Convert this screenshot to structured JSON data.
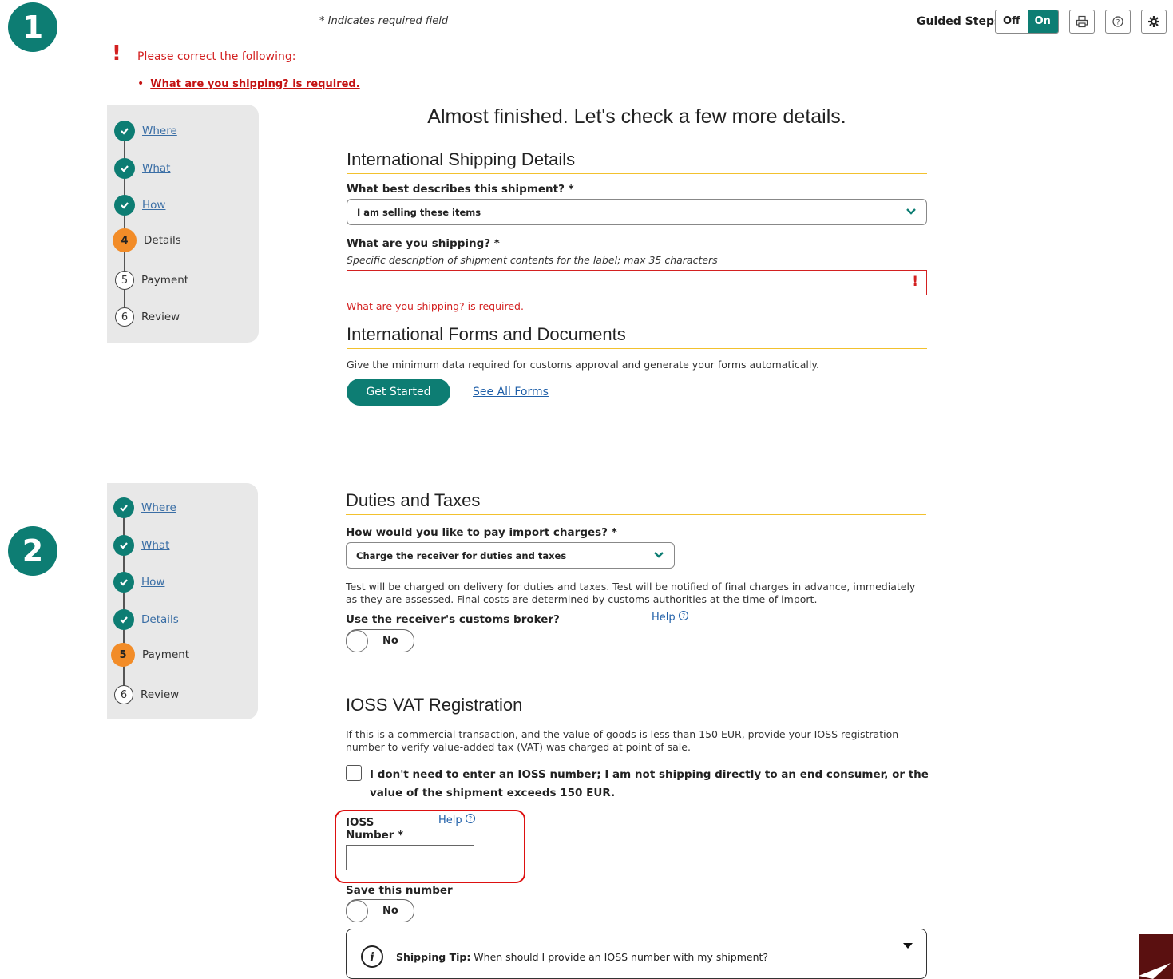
{
  "markers": {
    "one": "1",
    "two": "2"
  },
  "required_note": "* Indicates required field",
  "guided_steps": {
    "label": "Guided Steps",
    "off": "Off",
    "on": "On"
  },
  "toolbar": {
    "print_icon": "print-icon",
    "help_icon": "help-circle-icon",
    "settings_icon": "gear-icon"
  },
  "errors": {
    "icon": "!",
    "title": "Please correct the following:",
    "items": [
      "What are you shipping? is required."
    ]
  },
  "sidebar1": {
    "steps": [
      {
        "num": "✓",
        "label": "Where",
        "state": "done"
      },
      {
        "num": "✓",
        "label": "What",
        "state": "done"
      },
      {
        "num": "✓",
        "label": "How",
        "state": "done"
      },
      {
        "num": "4",
        "label": "Details",
        "state": "current"
      },
      {
        "num": "5",
        "label": "Payment",
        "state": "future"
      },
      {
        "num": "6",
        "label": "Review",
        "state": "future"
      }
    ]
  },
  "sidebar2": {
    "steps": [
      {
        "num": "✓",
        "label": "Where",
        "state": "done"
      },
      {
        "num": "✓",
        "label": "What",
        "state": "done"
      },
      {
        "num": "✓",
        "label": "How",
        "state": "done"
      },
      {
        "num": "✓",
        "label": "Details",
        "state": "done"
      },
      {
        "num": "5",
        "label": "Payment",
        "state": "current"
      },
      {
        "num": "6",
        "label": "Review",
        "state": "future"
      }
    ]
  },
  "main": {
    "headline": "Almost finished. Let's check a few more details.",
    "intl_shipping": {
      "title": "International Shipping Details",
      "describe_label": "What best describes this shipment? *",
      "describe_value": "I am selling these items",
      "shipping_label": "What are you shipping? *",
      "shipping_hint": "Specific description of shipment contents for the label; max 35 characters",
      "shipping_value": "",
      "shipping_error_icon": "!",
      "shipping_error": "What are you shipping? is required."
    },
    "intl_forms": {
      "title": "International Forms and Documents",
      "desc": "Give the minimum data required for customs approval and generate your forms automatically.",
      "get_started": "Get Started",
      "see_all": "See All Forms"
    },
    "duties": {
      "title": "Duties and Taxes",
      "pay_label": "How would you like to pay import charges? *",
      "pay_value": "Charge the receiver for duties and taxes",
      "desc": "Test will be charged on delivery for duties and taxes. Test will be notified of final charges in advance, immediately as they are assessed. Final costs are determined by customs authorities at the time of import.",
      "broker_label": "Use the receiver's customs broker?",
      "help": "Help",
      "broker_toggle": "No"
    },
    "ioss": {
      "title": "IOSS VAT Registration",
      "desc": "If this is a commercial transaction, and the value of goods is less than 150 EUR, provide your IOSS registration number to verify value-added tax (VAT) was charged at point of sale.",
      "checkbox_label": "I don't need to enter an IOSS number; I am not shipping directly to an end consumer, or the value of the shipment exceeds 150 EUR.",
      "number_label_1": "IOSS",
      "number_label_2": "Number *",
      "help": "Help",
      "number_value": "",
      "save_label": "Save this number",
      "save_toggle": "No",
      "tip_bold": "Shipping Tip:",
      "tip_text": " When should I provide an IOSS number with my shipment?"
    }
  },
  "colors": {
    "teal": "#0d7d73",
    "orange": "#f28c28",
    "error": "#d32020",
    "accent_line": "#f2c12e"
  }
}
